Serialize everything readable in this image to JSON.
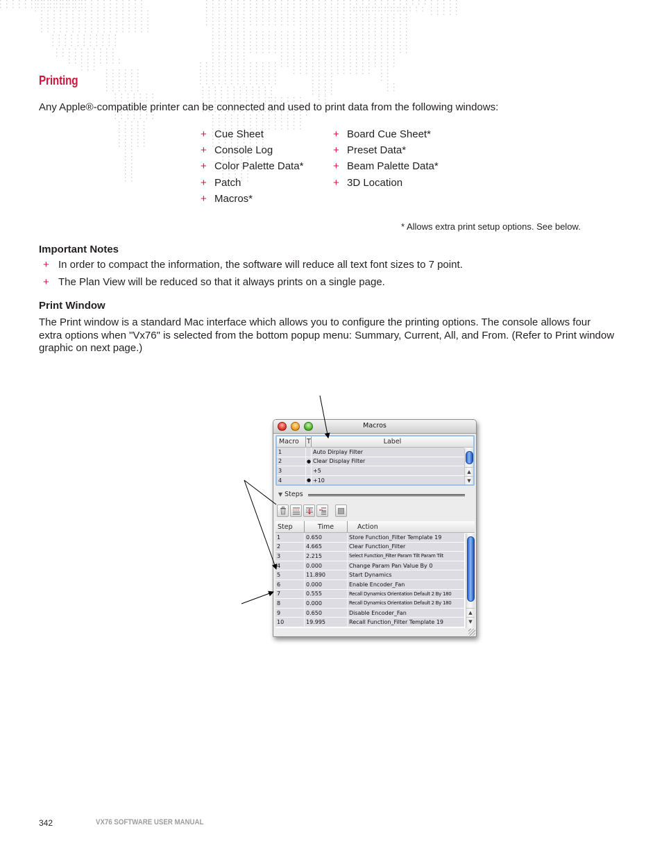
{
  "section": {
    "title": "Printing",
    "intro": "Any Apple®-compatible printer can be connected and used to print data from the following windows:"
  },
  "print_windows": {
    "bullet": "+",
    "column1": [
      "Cue Sheet",
      "Console Log",
      "Color Palette Data*",
      "Patch",
      "Macros*"
    ],
    "column2": [
      "Board Cue Sheet*",
      "Preset Data*",
      "Beam Palette Data*",
      "3D Location"
    ],
    "footnote": "*  Allows extra print setup options.  See below."
  },
  "important_notes": {
    "title": "Important Notes",
    "items": [
      "In order to compact the information, the software will reduce all text font sizes to 7 point.",
      "The Plan View will be reduced so that it always prints on a single page."
    ]
  },
  "print_window": {
    "title": "Print Window",
    "body": "The Print window is a standard Mac interface which allows you to configure the printing options. The console allows four extra options when \"Vx76\" is selected from the bottom popup menu: Summary, Current, All, and From. (Refer to Print window graphic on next page.)"
  },
  "macros_window": {
    "title": "Macros",
    "macro_table": {
      "columns": [
        "Macro",
        "T",
        "Label"
      ],
      "rows": [
        {
          "macro": "1",
          "t": "",
          "label": "Auto Dirplay Filter"
        },
        {
          "macro": "2",
          "t": "●",
          "label": "Clear Display Filter"
        },
        {
          "macro": "3",
          "t": "",
          "label": " +5"
        },
        {
          "macro": "4",
          "t": "●",
          "label": " +10"
        }
      ]
    },
    "steps_label": "Steps",
    "toolbar": {
      "icons": [
        "trash-icon",
        "insert-step-icon",
        "move-step-icon",
        "add-step-icon",
        "stop-icon"
      ]
    },
    "steps_table": {
      "columns": [
        "Step",
        "Time",
        "Action"
      ],
      "rows": [
        {
          "step": "1",
          "time": "0.650",
          "action": "Store Function_Filter  Template 19"
        },
        {
          "step": "2",
          "time": "4.665",
          "action": "Clear Function_Filter"
        },
        {
          "step": "3",
          "time": "2.215",
          "action": "Select Function_Filter  Param Tilt Param Tilt"
        },
        {
          "step": "4",
          "time": "0.000",
          "action": "Change Param Pan Value  By 0"
        },
        {
          "step": "5",
          "time": "11.890",
          "action": "Start Dynamics"
        },
        {
          "step": "6",
          "time": "0.000",
          "action": "Enable Encoder_Fan"
        },
        {
          "step": "7",
          "time": "0.555",
          "action": "Recall Dynamics Orientation Default 2 By 180"
        },
        {
          "step": "8",
          "time": "0.000",
          "action": "Recall Dynamics Orientation Default 2 By 180"
        },
        {
          "step": "9",
          "time": "0.650",
          "action": "Disable Encoder_Fan"
        },
        {
          "step": "10",
          "time": "19.995",
          "action": "Recall Function_Filter  Template 19"
        }
      ]
    }
  },
  "footer": {
    "page_number": "342",
    "manual_title": "VX76 SOFTWARE USER MANUAL"
  },
  "colors": {
    "accent": "#d2153f",
    "text": "#231f20",
    "footer_gray": "#9d9d9d",
    "map_dots": "#cfcfcf"
  }
}
